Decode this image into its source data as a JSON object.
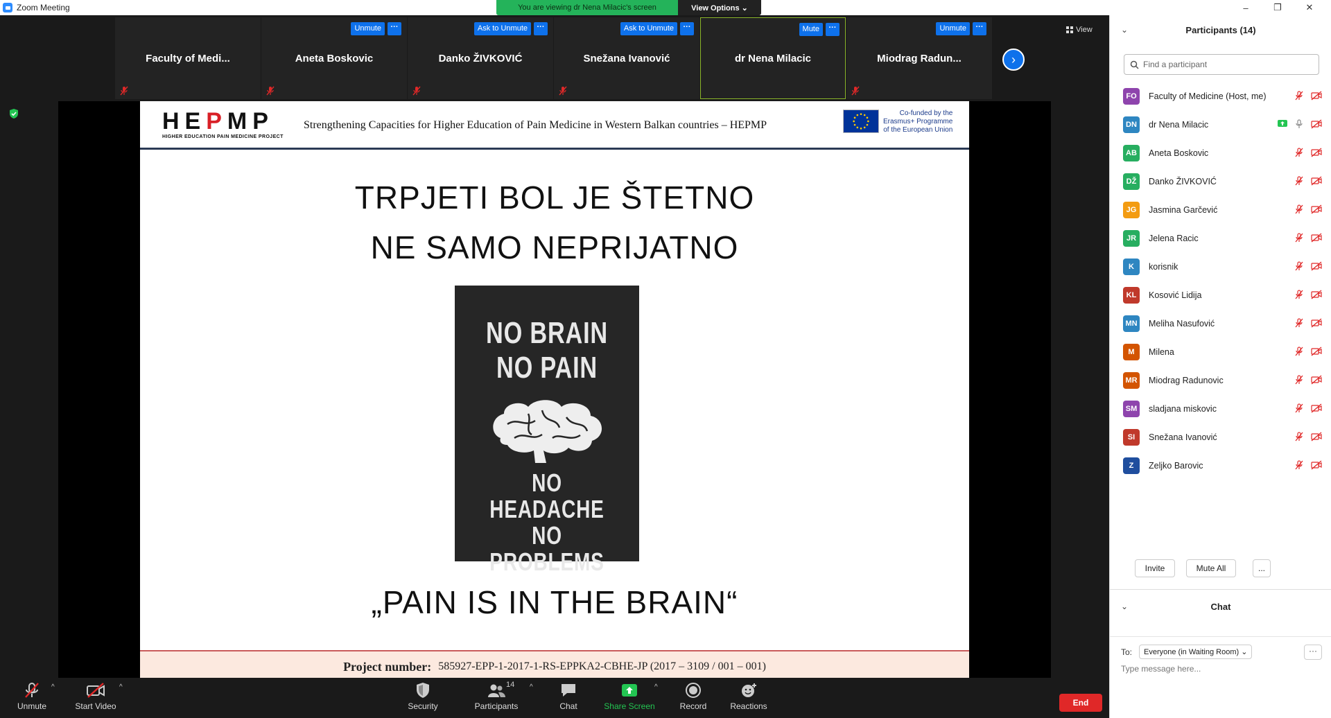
{
  "window": {
    "title": "Zoom Meeting",
    "minimize": "–",
    "maximize": "❐",
    "close": "✕"
  },
  "banner": {
    "viewing": "You are viewing dr Nena Milacic's screen",
    "view_options": "View Options ⌄"
  },
  "view_button": "View",
  "tiles": [
    {
      "name": "Faculty  of  Medi...",
      "buttons": []
    },
    {
      "name": "Aneta Boskovic",
      "buttons": [
        "Unmute"
      ]
    },
    {
      "name": "Danko ŽIVKOVIĆ",
      "buttons": [
        "Ask to Unmute"
      ]
    },
    {
      "name": "Snežana Ivanović",
      "buttons": [
        "Ask to Unmute"
      ]
    },
    {
      "name": "dr Nena Milacic",
      "buttons": [
        "Mute"
      ],
      "active": true
    },
    {
      "name": "Miodrag  Radun...",
      "buttons": [
        "Unmute"
      ]
    }
  ],
  "tile_more": "···",
  "next_arrow": "›",
  "slide": {
    "logo": "HEPMP",
    "logo_sub": "HIGHER EDUCATION PAIN MEDICINE PROJECT",
    "header_title": "Strengthening Capacities for Higher Education of Pain Medicine in Western Balkan countries – HEPMP",
    "eu_l1": "Co-funded by the",
    "eu_l2": "Erasmus+ Programme",
    "eu_l3": "of the European Union",
    "line1": "TRPJETI BOL JE ŠTETNO",
    "line2": "NE SAMO NEPRIJATNO",
    "poster_top_1": "NO BRAIN",
    "poster_top_2": "NO PAIN",
    "poster_bottom_1": "NO HEADACHE",
    "poster_bottom_2": "NO PROBLEMS",
    "quote": "„PAIN IS IN THE BRAIN“",
    "footer_label": "Project number:",
    "footer_value": "585927-EPP-1-2017-1-RS-EPPKA2-CBHE-JP  (2017 – 3109 / 001 – 001)"
  },
  "toolbar": {
    "unmute": "Unmute",
    "start_video": "Start Video",
    "security": "Security",
    "participants": "Participants",
    "participants_count": "14",
    "chat": "Chat",
    "share_screen": "Share Screen",
    "record": "Record",
    "reactions": "Reactions",
    "end": "End",
    "caret": "^"
  },
  "panel": {
    "title": "Participants (14)",
    "collapse": "⌄",
    "search_placeholder": "Find a participant",
    "participants": [
      {
        "initials": "FO",
        "name": "Faculty of Medicine (Host, me)",
        "color": "#8e44ad"
      },
      {
        "initials": "DN",
        "name": "dr Nena Milacic",
        "color": "#2e86c1"
      },
      {
        "initials": "AB",
        "name": "Aneta Boskovic",
        "color": "#27ae60"
      },
      {
        "initials": "DŽ",
        "name": "Danko ŽIVKOVIĆ",
        "color": "#27ae60"
      },
      {
        "initials": "JG",
        "name": "Jasmina Garčević",
        "color": "#f39c12"
      },
      {
        "initials": "JR",
        "name": "Jelena Racic",
        "color": "#27ae60"
      },
      {
        "initials": "K",
        "name": "korisnik",
        "color": "#2e86c1"
      },
      {
        "initials": "KL",
        "name": "Kosović Lidija",
        "color": "#c0392b"
      },
      {
        "initials": "MN",
        "name": "Meliha Nasufović",
        "color": "#2e86c1"
      },
      {
        "initials": "M",
        "name": "Milena",
        "color": "#d35400"
      },
      {
        "initials": "MR",
        "name": "Miodrag Radunovic",
        "color": "#d35400"
      },
      {
        "initials": "SM",
        "name": "sladjana miskovic",
        "color": "#8e44ad"
      },
      {
        "initials": "SI",
        "name": "Snežana Ivanović",
        "color": "#c0392b"
      },
      {
        "initials": "Z",
        "name": "Zeljko Barovic",
        "color": "#1f4e9e"
      }
    ],
    "invite": "Invite",
    "mute_all": "Mute All",
    "more": "..."
  },
  "chat": {
    "title": "Chat",
    "to_label": "To:",
    "to_value": "Everyone (in Waiting Room) ⌄",
    "more": "···",
    "placeholder": "Type message here..."
  }
}
